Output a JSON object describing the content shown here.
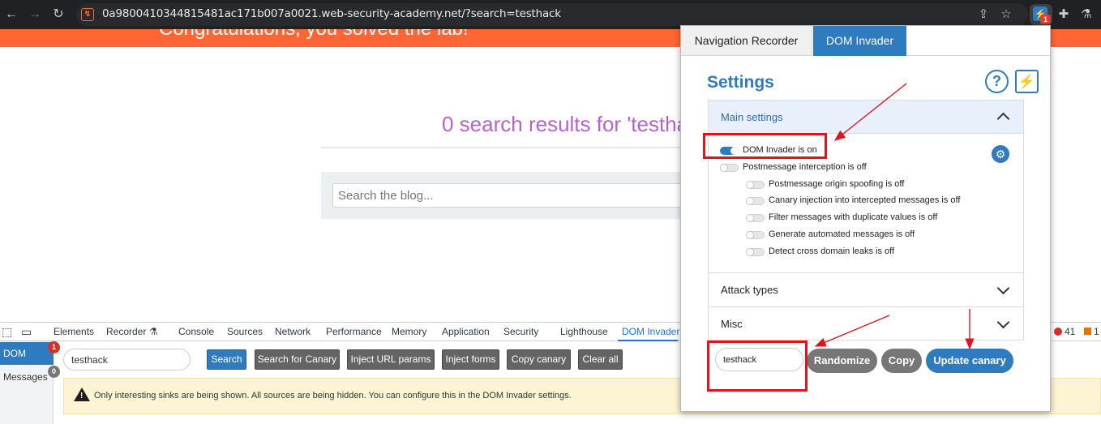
{
  "browser": {
    "url": "0a9800410344815481ac171b007a0021.web-security-academy.net/?search=testhack",
    "extension_badge": "1"
  },
  "page": {
    "banner_text": "Congratulations, you solved the lab!",
    "results_heading": "0 search results for 'testha",
    "search_placeholder": "Search the blog..."
  },
  "devtools": {
    "tabs": [
      "Elements",
      "Recorder ⚗",
      "Console",
      "Sources",
      "Network",
      "Performance",
      "Memory",
      "Application",
      "Security",
      "Lighthouse",
      "DOM Invader"
    ],
    "active_tab": "DOM Invader",
    "error_count": "41",
    "info_count": "1",
    "sidebar": {
      "dom_label": "DOM",
      "dom_badge": "1",
      "messages_label": "Messages",
      "messages_badge": "0"
    },
    "search_value": "testhack",
    "buttons": {
      "search": "Search",
      "search_canary": "Search for Canary",
      "inject_url": "Inject URL params",
      "inject_forms": "Inject forms",
      "copy_canary": "Copy canary",
      "clear_all": "Clear all"
    },
    "warning_text": "Only interesting sinks are being shown. All sources are being hidden. You can configure this in the DOM Invader settings."
  },
  "popup": {
    "tabs": [
      "Navigation Recorder",
      "DOM Invader"
    ],
    "active_tab": "DOM Invader",
    "title": "Settings",
    "help_symbol": "?",
    "main_settings_label": "Main settings",
    "options": {
      "dom_invader": {
        "label": "DOM Invader is on",
        "on": true
      },
      "postmessage": {
        "label": "Postmessage interception is off",
        "on": false
      },
      "origin_spoofing": {
        "label": "Postmessage origin spoofing is off",
        "on": false
      },
      "canary_injection": {
        "label": "Canary injection into intercepted messages is off",
        "on": false
      },
      "filter_duplicates": {
        "label": "Filter messages with duplicate values is off",
        "on": false
      },
      "generate_automated": {
        "label": "Generate automated messages is off",
        "on": false
      },
      "cross_domain": {
        "label": "Detect cross domain leaks is off",
        "on": false
      }
    },
    "attack_types_label": "Attack types",
    "misc_label": "Misc",
    "canary_value": "testhack",
    "buttons": {
      "randomize": "Randomize",
      "copy": "Copy",
      "update_canary": "Update canary"
    }
  },
  "colors": {
    "accent": "#2e7bbf",
    "banner": "#ff6633",
    "results_purple": "#b463c7",
    "annotation_red": "#e1141c"
  }
}
